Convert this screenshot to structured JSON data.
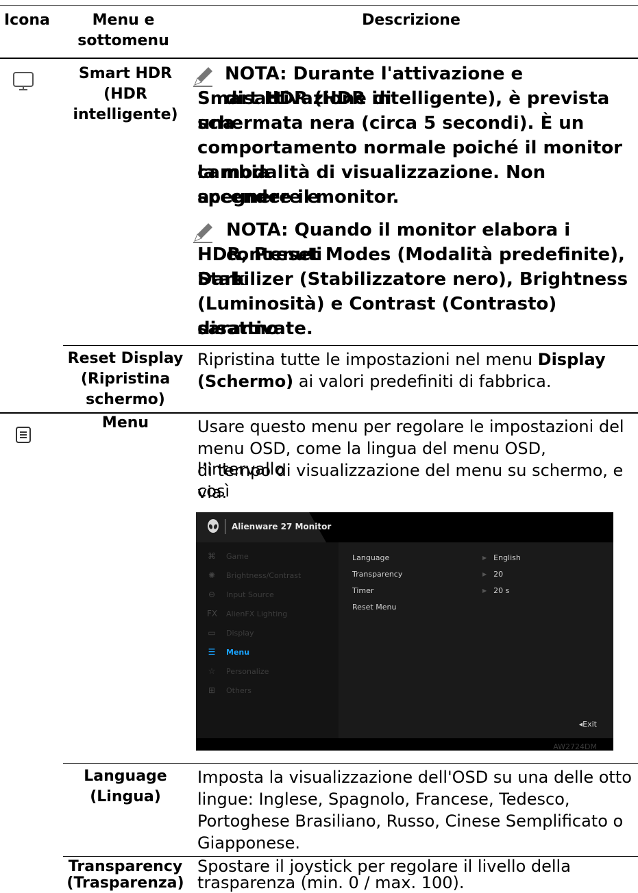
{
  "header": {
    "col1": "Icona",
    "col2_line1": "Menu e",
    "col2_line2": "sottomenu",
    "col3": "Descrizione"
  },
  "rows": {
    "smart_hdr": {
      "name_line1": "Smart HDR",
      "name_line2": "(HDR",
      "name_line3": "intelligente)",
      "note1_lines": [
        "NOTA: Durante l'attivazione e disattivazione di",
        "Smart HDR (HDR intelligente), è prevista una",
        "schermata nera (circa 5 secondi). È un",
        "comportamento normale poiché il monitor cambia",
        "la modalità di visualizzazione. Non accendere e",
        "spegnere il monitor."
      ],
      "note2_lines": [
        "NOTA: Quando il monitor elabora i contenuti",
        "HDR, Preset Modes (Modalità predefinite), Dark",
        "Stabilizer (Stabilizzatore nero), Brightness",
        "(Luminosità) e Contrast (Contrasto) saranno",
        "disattivate."
      ]
    },
    "reset_display": {
      "name_line1": "Reset Display",
      "name_line2": "(Ripristina",
      "name_line3": "schermo)",
      "desc_line1_a": "Ripristina tutte le impostazioni nel menu ",
      "desc_line1_b": "Display",
      "desc_line2_a": "(Schermo)",
      "desc_line2_b": " ai valori predefiniti di fabbrica."
    },
    "menu": {
      "name": "Menu",
      "desc_lines": [
        "Usare questo menu per regolare le impostazioni del",
        "menu OSD, come la lingua del menu OSD, l’intervallo",
        "di tempo di visualizzazione del menu su schermo, e così",
        "via."
      ]
    },
    "language": {
      "name_line1": "Language",
      "name_line2": "(Lingua)",
      "desc_lines": [
        "Imposta la visualizzazione dell'OSD su una delle otto",
        "lingue: Inglese, Spagnolo, Francese, Tedesco,",
        "Portoghese Brasiliano, Russo, Cinese Semplificato o",
        "Giapponese."
      ]
    },
    "transparency": {
      "name_line1": "Transparency",
      "name_line2": "(Trasparenza)",
      "desc_lines": [
        "Spostare il joystick per regolare il livello della",
        "trasparenza (min. 0 / max. 100)."
      ]
    }
  },
  "osd": {
    "title": "Alienware 27 Monitor",
    "menu_items": [
      "Game",
      "Brightness/Contrast",
      "Input Source",
      "AlienFX Lighting",
      "Display",
      "Menu",
      "Personalize",
      "Others"
    ],
    "menu_icons": [
      "gamepad-icon",
      "sun-icon",
      "input-icon",
      "fx-icon",
      "display-icon",
      "menu-icon",
      "star-icon",
      "others-icon"
    ],
    "active_item": "Menu",
    "options": [
      "Language",
      "Transparency",
      "Timer",
      "Reset Menu"
    ],
    "values": [
      "English",
      "20",
      "20 s"
    ],
    "exit_label": "◂Exit",
    "model": "AW2724DM",
    "accent_color": "#19a3ff"
  }
}
